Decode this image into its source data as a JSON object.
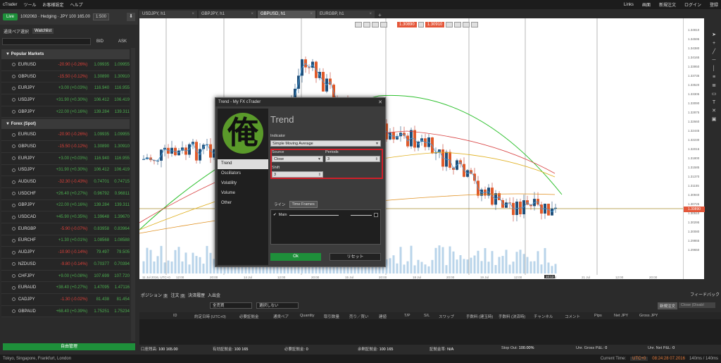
{
  "menubar": {
    "app": "cTrader",
    "items": [
      "ツール",
      "お客様設定",
      "ヘルプ"
    ],
    "right": [
      "Links",
      "画面",
      "新規注文",
      "ログイン",
      "登録"
    ]
  },
  "account": {
    "live": "Live",
    "id": "1002063 · Hedging · JPY 100 165.00",
    "leverage": "1:500"
  },
  "left_tabs": [
    "通貨ペア選択",
    "Watchlist"
  ],
  "watch_cols": {
    "bid": "BID",
    "ask": "ASK"
  },
  "sections": [
    {
      "title": "Popular Markets",
      "rows": [
        {
          "sym": "EURUSD",
          "chg": "-20.90 (-0.26%)",
          "bid": "1.09935",
          "ask": "1.09955",
          "neg": true
        },
        {
          "sym": "GBPUSD",
          "chg": "-15.50 (-0.12%)",
          "bid": "1.30890",
          "ask": "1.30910",
          "neg": true
        },
        {
          "sym": "EURJPY",
          "chg": "+3.00 (+0.03%)",
          "bid": "116.940",
          "ask": "116.955",
          "neg": false
        },
        {
          "sym": "USDJPY",
          "chg": "+31.90 (+0.30%)",
          "bid": "106.412",
          "ask": "106.419",
          "neg": false
        },
        {
          "sym": "GBPJPY",
          "chg": "+22.00 (+0.16%)",
          "bid": "139.284",
          "ask": "139.311",
          "neg": false
        }
      ]
    },
    {
      "title": "Forex (Spot)",
      "rows": [
        {
          "sym": "EURUSD",
          "chg": "-20.90 (-0.26%)",
          "bid": "1.09935",
          "ask": "1.09955",
          "neg": true
        },
        {
          "sym": "GBPUSD",
          "chg": "-15.50 (-0.12%)",
          "bid": "1.30890",
          "ask": "1.30910",
          "neg": true
        },
        {
          "sym": "EURJPY",
          "chg": "+3.00 (+0.03%)",
          "bid": "116.940",
          "ask": "116.955",
          "neg": false
        },
        {
          "sym": "USDJPY",
          "chg": "+31.90 (+0.30%)",
          "bid": "106.412",
          "ask": "106.419",
          "neg": false
        },
        {
          "sym": "AUDUSD",
          "chg": "-32.30 (-0.43%)",
          "bid": "0.74701",
          "ask": "0.74715",
          "neg": true
        },
        {
          "sym": "USDCHF",
          "chg": "+26.40 (+0.27%)",
          "bid": "0.96792",
          "ask": "0.96811",
          "neg": false
        },
        {
          "sym": "GBPJPY",
          "chg": "+22.00 (+0.16%)",
          "bid": "139.284",
          "ask": "139.311",
          "neg": false
        },
        {
          "sym": "USDCAD",
          "chg": "+45.90 (+0.35%)",
          "bid": "1.39648",
          "ask": "1.39670",
          "neg": false
        },
        {
          "sym": "EURGBP",
          "chg": "-5.90 (-0.07%)",
          "bid": "0.83958",
          "ask": "0.83964",
          "neg": true
        },
        {
          "sym": "EURCHF",
          "chg": "+1.30 (+0.01%)",
          "bid": "1.08568",
          "ask": "1.08588",
          "neg": false
        },
        {
          "sym": "AUDJPY",
          "chg": "-10.90 (-0.14%)",
          "bid": "79.497",
          "ask": "79.505",
          "neg": true
        },
        {
          "sym": "NZDUSD",
          "chg": "-9.80 (-0.14%)",
          "bid": "0.70377",
          "ask": "0.70394",
          "neg": true
        },
        {
          "sym": "CHFJPY",
          "chg": "+9.00 (+0.08%)",
          "bid": "107.699",
          "ask": "107.720",
          "neg": false
        },
        {
          "sym": "EURAUD",
          "chg": "+38.40 (+0.27%)",
          "bid": "1.47095",
          "ask": "1.47116",
          "neg": false
        },
        {
          "sym": "CADJPY",
          "chg": "-1.30 (-0.02%)",
          "bid": "81.438",
          "ask": "81.454",
          "neg": true
        },
        {
          "sym": "GBPAUD",
          "chg": "+68.40 (+0.39%)",
          "bid": "1.75251",
          "ask": "1.75234",
          "neg": false
        }
      ]
    }
  ],
  "trade_button": "自由管理",
  "status": {
    "servers": "Tokyo, Singapore, Frankfurt, London",
    "current_time_label": "Current Time:",
    "tz": "UTC+0",
    "time": "08:24:28 07.2016",
    "latency": "140ms / 140ms"
  },
  "chart_tabs": [
    {
      "label": "USDJPY, h1"
    },
    {
      "label": "GBPJPY, h1"
    },
    {
      "label": "GBPUSD, h1"
    },
    {
      "label": "EURGBP, h1"
    }
  ],
  "chart_prices": {
    "bid": "1.30890",
    "ask": "1.30910",
    "current": "1.30890"
  },
  "chart_data": {
    "type": "candlestick",
    "symbol": "GBPUSD",
    "timeframe": "h1",
    "y_ticks": [
      "1.34810",
      "1.34595",
      "1.34380",
      "1.34165",
      "1.33950",
      "1.33735",
      "1.33520",
      "1.33305",
      "1.33090",
      "1.32875",
      "1.32660",
      "1.32445",
      "1.32230",
      "1.32015",
      "1.31800",
      "1.31585",
      "1.31370",
      "1.31155",
      "1.30940",
      "1.30725",
      "1.30510",
      "1.30295",
      "1.30080",
      "1.29865",
      "1.29650"
    ],
    "x_ticks": [
      "11 Jul 2016, UTC+0",
      "12:00",
      "20:00",
      "14 Jul",
      "12:00",
      "20:00",
      "15 Jul",
      "20:00",
      "18 Jul",
      "20:00",
      "19 Jul",
      "12:00",
      "20 Jul",
      "21 Jul",
      "12:00",
      "20:00"
    ],
    "time_badge": "10:13"
  },
  "dialog": {
    "title": "Trend - My FX cTrader",
    "logo_char": "俺",
    "heading": "Trend",
    "nav": [
      "Trend",
      "Oscillators",
      "Volatility",
      "Volume",
      "Other"
    ],
    "indicator_label": "Indicator",
    "indicator_value": "Simple Moving Average",
    "source_label": "Source",
    "source_value": "Close",
    "periods_label": "Periods",
    "periods_value": "3",
    "shift_label": "Shift",
    "shift_value": "3",
    "tab_line": "ライン",
    "tab_tf": "Time Frames",
    "main_label": "Main",
    "ok": "Ok",
    "reset": "リセット"
  },
  "bottom": {
    "tabs": [
      {
        "label": "ポジション",
        "count": "0"
      },
      {
        "label": "注文",
        "count": "0"
      },
      {
        "label": "決済履歴"
      },
      {
        "label": "入出金"
      }
    ],
    "feedback": "フィードバック",
    "filter1": "全売買",
    "filter2": "選択しない",
    "new_order": "新規注文",
    "close_sel": "Close (Disabl",
    "cols": [
      "ID",
      "約定日時 (UTC+0)",
      "必要証拠金",
      "通貨ペア",
      "Quantity",
      "取引数量",
      "売り／買い",
      "建値",
      "T/P",
      "S/L",
      "スワップ",
      "手数料 (建玉時)",
      "手数料 (決済時)",
      "チャンネル",
      "コメント",
      "Pips",
      "Net JPY",
      "Gross JPY"
    ],
    "summary": [
      {
        "l": "口座残高:",
        "v": "100 165.00"
      },
      {
        "l": "有効証拠金:",
        "v": "100 165"
      },
      {
        "l": "必要証拠金:",
        "v": "0"
      },
      {
        "l": "余剰証拠金:",
        "v": "100 165"
      },
      {
        "l": "証拠金率:",
        "v": "N/A"
      },
      {
        "l": "Stop Out:",
        "v": "100.00%"
      },
      {
        "l": "Unr. Gross P&L:",
        "v": "0"
      },
      {
        "l": "Unr. Net P&L:",
        "v": "0"
      }
    ]
  }
}
